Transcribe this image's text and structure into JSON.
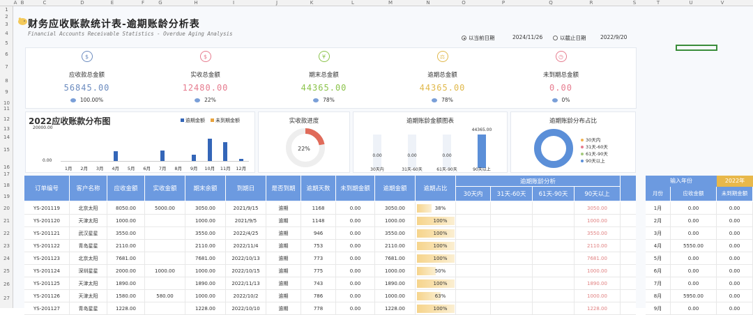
{
  "columns": [
    "A",
    "B",
    "C",
    "D",
    "E",
    "F",
    "G",
    "H",
    "I",
    "J",
    "K",
    "L",
    "M",
    "N",
    "O",
    "P",
    "Q",
    "R",
    "S",
    "T",
    "U",
    "V"
  ],
  "rows": [
    "1",
    "2",
    "3",
    "4",
    "5",
    "6",
    "7",
    "8",
    "9",
    "10",
    "11",
    "12",
    "13",
    "14",
    "15",
    "16",
    "17",
    "18",
    "19",
    "20",
    "21",
    "22",
    "23",
    "24",
    "25",
    "26",
    "27"
  ],
  "title": "财务应收账款统计表-逾期账龄分析表",
  "subtitle": "Financial Accounts Receivable Statistics - Overdue Aging Analysis",
  "options": {
    "current_label": "以当前日期",
    "current_date": "2024/11/26",
    "cutoff_label": "以截止日期",
    "cutoff_date": "2022/9/20"
  },
  "kpis": [
    {
      "label": "应收款总金额",
      "value": "56845.00",
      "pct": "100.00%",
      "color": "#6b8bbf",
      "icon": "money-bag-icon",
      "icon_glyph": "$"
    },
    {
      "label": "实收总金额",
      "value": "12480.00",
      "pct": "22%",
      "color": "#e67b8e",
      "icon": "cash-icon",
      "icon_glyph": "$"
    },
    {
      "label": "期末总金额",
      "value": "44365.00",
      "pct": "78%",
      "color": "#8bc34a",
      "icon": "yuan-icon",
      "icon_glyph": "¥"
    },
    {
      "label": "逾期总金额",
      "value": "44365.00",
      "pct": "78%",
      "color": "#e0b84a",
      "icon": "scale-icon",
      "icon_glyph": "⚖"
    },
    {
      "label": "未到期总金额",
      "value": "0.00",
      "pct": "0%",
      "color": "#e67b8e",
      "icon": "clock-icon",
      "icon_glyph": "◷"
    }
  ],
  "dist_chart": {
    "title": "2022应收账款分布图",
    "legend": [
      "逾期金额",
      "未到期金额"
    ],
    "legend_colors": [
      "#3466b8",
      "#e8a33d"
    ],
    "ymax_label": "20000.00",
    "ymin_label": "0.00",
    "chart_data": {
      "type": "bar",
      "categories": [
        "1月",
        "2月",
        "3月",
        "4月",
        "5月",
        "6月",
        "7月",
        "8月",
        "9月",
        "10月",
        "11月",
        "12月"
      ],
      "series": [
        {
          "name": "逾期金额",
          "values": [
            0,
            0,
            0,
            5550,
            0,
            0,
            5950,
            0,
            3550,
            13000,
            11000,
            1200
          ]
        },
        {
          "name": "未到期金额",
          "values": [
            0,
            0,
            0,
            0,
            0,
            0,
            0,
            0,
            0,
            0,
            0,
            0
          ]
        }
      ],
      "ylim": [
        0,
        20000
      ]
    }
  },
  "progress": {
    "title": "实收款进度",
    "pct": "22%",
    "pct_value": 0.22,
    "color": "#e06b5a"
  },
  "overdue_chart": {
    "title": "逾期账龄金额图表",
    "top_label": "44365.00",
    "chart_data": {
      "type": "bar",
      "categories": [
        "30天内",
        "31天-60天",
        "61天-90天",
        "90天以上"
      ],
      "values": [
        0,
        0,
        0,
        44365
      ],
      "value_labels": [
        "0.00",
        "0.00",
        "0.00",
        "44365.00"
      ]
    }
  },
  "ratio_chart": {
    "title": "逾期账龄分布占比",
    "legend": [
      "30天内",
      "31天-60天",
      "61天-90天",
      "90天以上"
    ],
    "colors": [
      "#f1b04c",
      "#e67b8e",
      "#a3c97c",
      "#5b8fd8"
    ]
  },
  "table": {
    "headers": [
      "订单编号",
      "客户名称",
      "应收金额",
      "实收金额",
      "期末余额",
      "到期日",
      "是否到期",
      "逾期天数",
      "未到期金额",
      "逾期金额",
      "逾期占比"
    ],
    "aging_group": "逾期账龄分析",
    "aging_headers": [
      "30天内",
      "31天-60天",
      "61天-90天",
      "90天以上"
    ],
    "rows": [
      [
        "YS-201119",
        "北京太阳",
        "8050.00",
        "5000.00",
        "3050.00",
        "2021/9/15",
        "逾期",
        "1168",
        "0.00",
        "3050.00",
        "38%",
        "",
        "",
        "",
        "3050.00"
      ],
      [
        "YS-201120",
        "天津太阳",
        "1000.00",
        "",
        "1000.00",
        "2021/9/5",
        "逾期",
        "1148",
        "0.00",
        "1000.00",
        "100%",
        "",
        "",
        "",
        "1000.00"
      ],
      [
        "YS-201121",
        "武汉星星",
        "3550.00",
        "",
        "3550.00",
        "2022/4/25",
        "逾期",
        "946",
        "0.00",
        "3550.00",
        "100%",
        "",
        "",
        "",
        "3550.00"
      ],
      [
        "YS-201122",
        "青岛星星",
        "2110.00",
        "",
        "2110.00",
        "2022/11/4",
        "逾期",
        "753",
        "0.00",
        "2110.00",
        "100%",
        "",
        "",
        "",
        "2110.00"
      ],
      [
        "YS-201123",
        "北京太阳",
        "7681.00",
        "",
        "7681.00",
        "2022/10/13",
        "逾期",
        "773",
        "0.00",
        "7681.00",
        "100%",
        "",
        "",
        "",
        "7681.00"
      ],
      [
        "YS-201124",
        "深圳星星",
        "2000.00",
        "1000.00",
        "1000.00",
        "2022/10/15",
        "逾期",
        "775",
        "0.00",
        "1000.00",
        "50%",
        "",
        "",
        "",
        "1000.00"
      ],
      [
        "YS-201125",
        "天津太阳",
        "1890.00",
        "",
        "1890.00",
        "2022/11/13",
        "逾期",
        "743",
        "0.00",
        "1890.00",
        "100%",
        "",
        "",
        "",
        "1890.00"
      ],
      [
        "YS-201126",
        "天津太阳",
        "1580.00",
        "580.00",
        "1000.00",
        "2022/10/2",
        "逾期",
        "786",
        "0.00",
        "1000.00",
        "63%",
        "",
        "",
        "",
        "1000.00"
      ],
      [
        "YS-201127",
        "青岛星星",
        "1228.00",
        "",
        "1228.00",
        "2022/10/10",
        "逾期",
        "778",
        "0.00",
        "1228.00",
        "100%",
        "",
        "",
        "",
        "1228.00"
      ]
    ],
    "pct_values": [
      0.38,
      1,
      1,
      1,
      1,
      0.5,
      1,
      0.63,
      1
    ]
  },
  "side_table": {
    "header": "输入年份",
    "year": "2022年",
    "cols": [
      "月份",
      "应收金额",
      "未到期金额"
    ],
    "rows": [
      [
        "1月",
        "0.00",
        "0.00"
      ],
      [
        "2月",
        "0.00",
        "0.00"
      ],
      [
        "3月",
        "0.00",
        "0.00"
      ],
      [
        "4月",
        "5550.00",
        "0.00"
      ],
      [
        "5月",
        "0.00",
        "0.00"
      ],
      [
        "6月",
        "0.00",
        "0.00"
      ],
      [
        "7月",
        "0.00",
        "0.00"
      ],
      [
        "8月",
        "5950.00",
        "0.00"
      ],
      [
        "9月",
        "0.00",
        "0.00"
      ]
    ]
  }
}
